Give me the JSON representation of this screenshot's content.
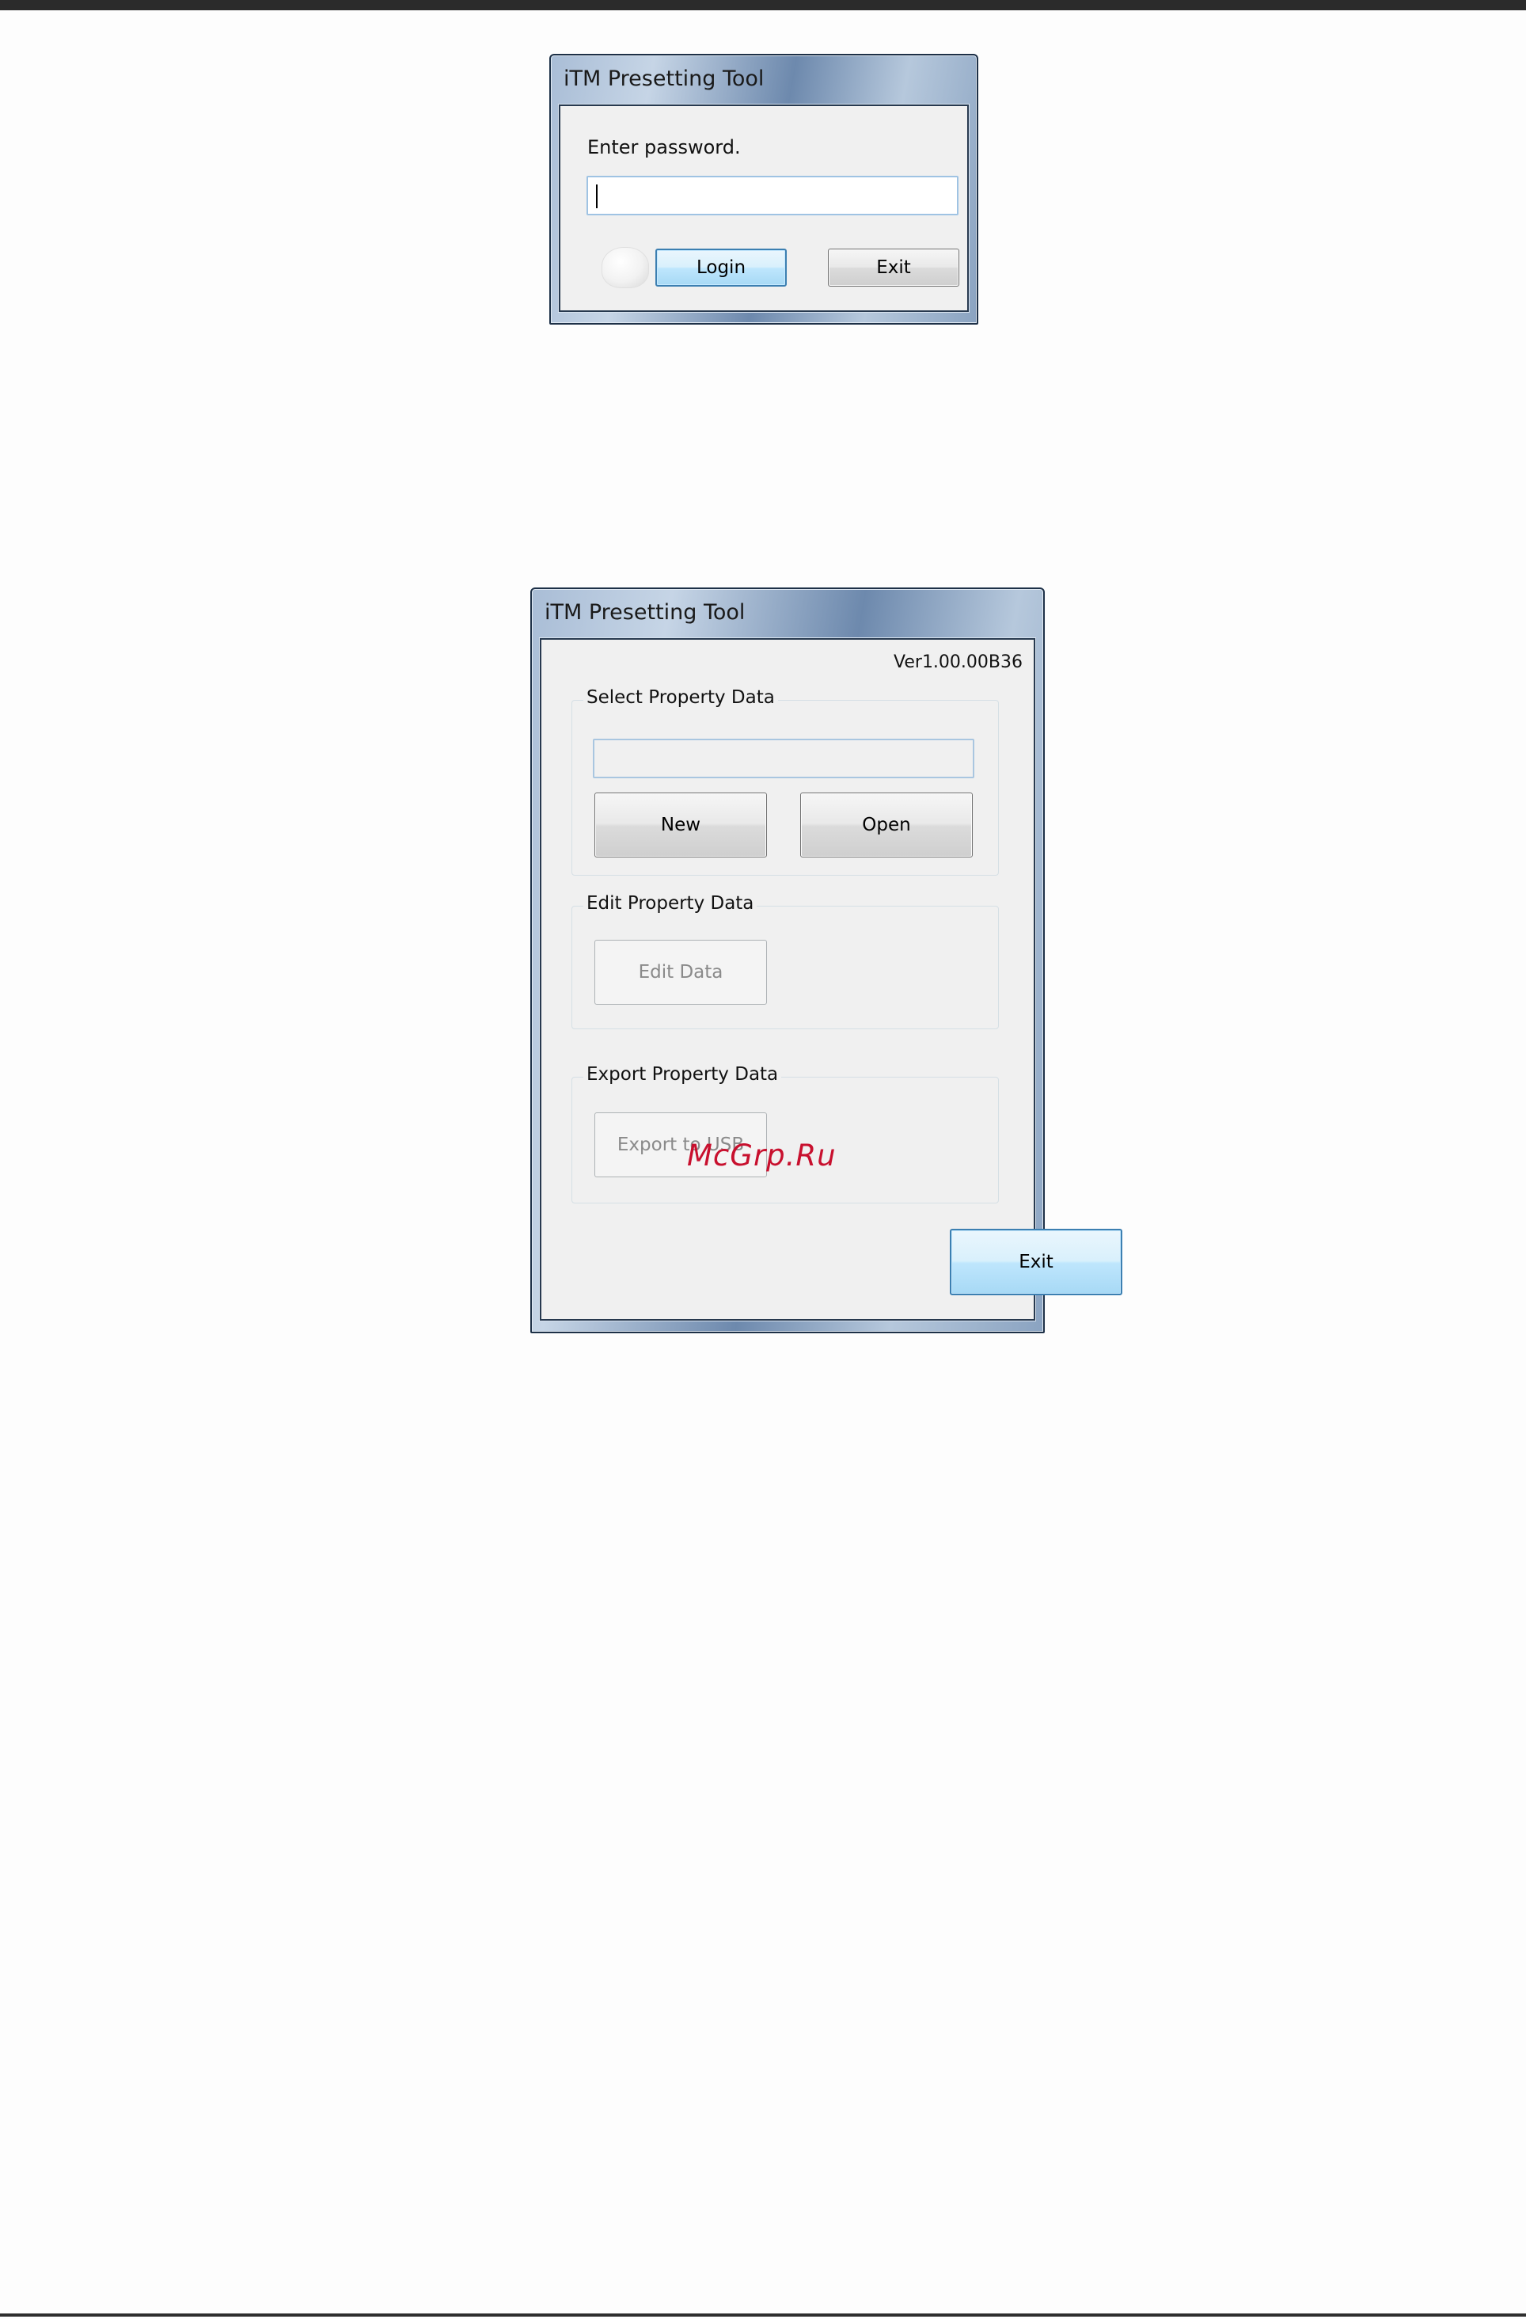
{
  "login_dialog": {
    "title": "iTM Presetting Tool",
    "prompt": "Enter password.",
    "password_value": "",
    "login_label": "Login",
    "exit_label": "Exit"
  },
  "main_dialog": {
    "title": "iTM Presetting Tool",
    "version": "Ver1.00.00B36",
    "select_group": {
      "legend": "Select Property Data",
      "path_value": "",
      "new_label": "New",
      "open_label": "Open"
    },
    "edit_group": {
      "legend": "Edit Property Data",
      "edit_label": "Edit Data"
    },
    "export_group": {
      "legend": "Export Property Data",
      "export_label": "Export to USB"
    },
    "exit_label": "Exit"
  },
  "watermark": "McGrp.Ru"
}
